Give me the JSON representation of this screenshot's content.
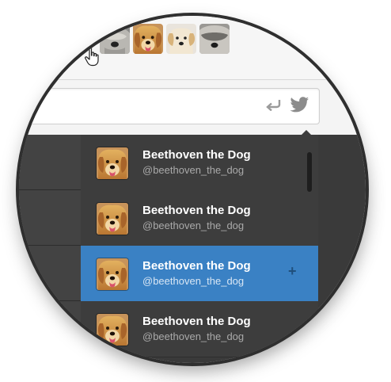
{
  "thumbnails": [
    {
      "icon": "sheepdog-thumb-1"
    },
    {
      "icon": "golden-retriever-thumb"
    },
    {
      "icon": "puppy-thumb"
    },
    {
      "icon": "sheepdog-thumb-2"
    }
  ],
  "compose": {
    "reply_icon": "reply-arrow-icon",
    "bird_icon": "twitter-bird-icon"
  },
  "suggestions": [
    {
      "name": "Beethoven the Dog",
      "handle": "@beethoven_the_dog",
      "selected": false
    },
    {
      "name": "Beethoven the Dog",
      "handle": "@beethoven_the_dog",
      "selected": false
    },
    {
      "name": "Beethoven the Dog",
      "handle": "@beethoven_the_dog",
      "selected": true,
      "action": "+"
    },
    {
      "name": "Beethoven the Dog",
      "handle": "@beethoven_the_dog",
      "selected": false
    }
  ],
  "colors": {
    "selected_row": "#3a81c4",
    "row_bg": "#3d3d3d",
    "lens_border": "#2f2f2f"
  }
}
